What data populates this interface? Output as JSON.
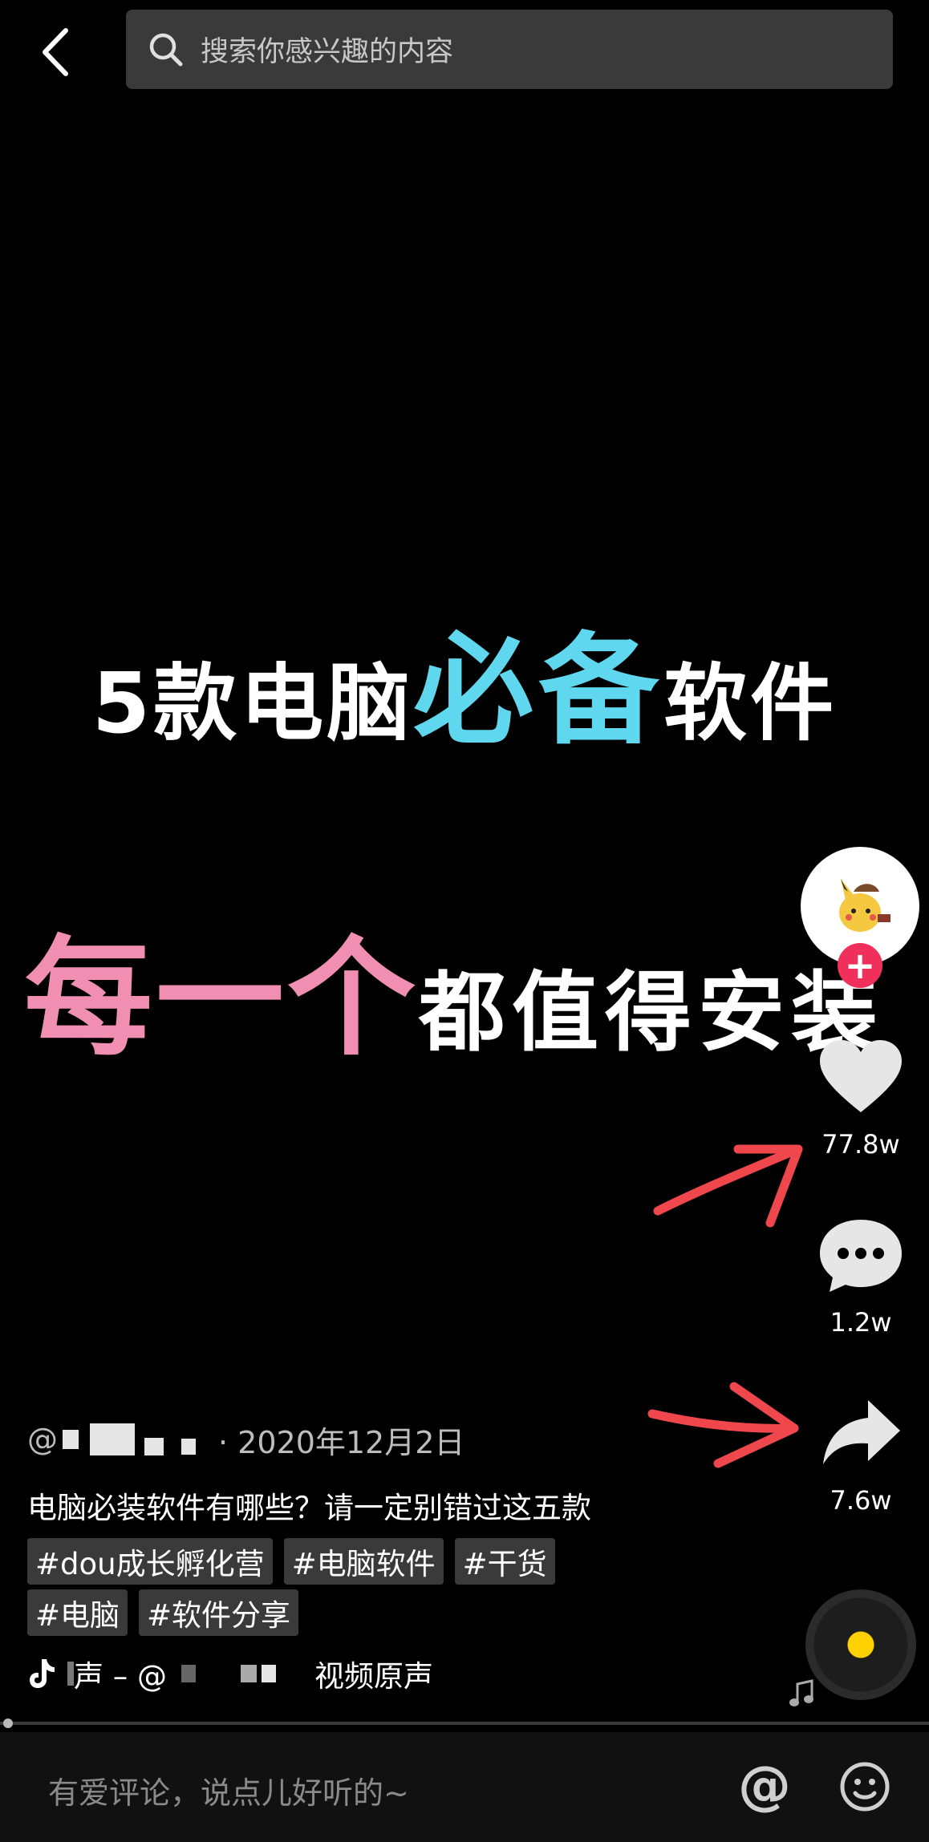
{
  "search": {
    "placeholder": "搜索你感兴趣的内容"
  },
  "video_text": {
    "line1_a": "5款电脑",
    "line1_b": "必备",
    "line1_c": "软件",
    "line2_a": "每一个",
    "line2_b": "都值得安装"
  },
  "rail": {
    "follow_symbol": "+",
    "likes": "77.8w",
    "comments": "1.2w",
    "shares": "7.6w"
  },
  "post": {
    "author_prefix": "@",
    "date": "· 2020年12月2日",
    "description": "电脑必装软件有哪些？请一定别错过这五款",
    "tags_row1": [
      "#dou成长孵化营",
      "#电脑软件",
      "#干货"
    ],
    "tags_row2": [
      "#电脑",
      "#软件分享"
    ],
    "music_prefix": "声 – @",
    "music_suffix": "视频原声"
  },
  "comment": {
    "placeholder": "有爱评论，说点儿好听的~",
    "at_symbol": "@"
  },
  "colors": {
    "highlight_cyan": "#5fd7ef",
    "highlight_pink": "#f08fb2",
    "follow_red": "#f0305a",
    "arrow_red": "#f0474c"
  }
}
